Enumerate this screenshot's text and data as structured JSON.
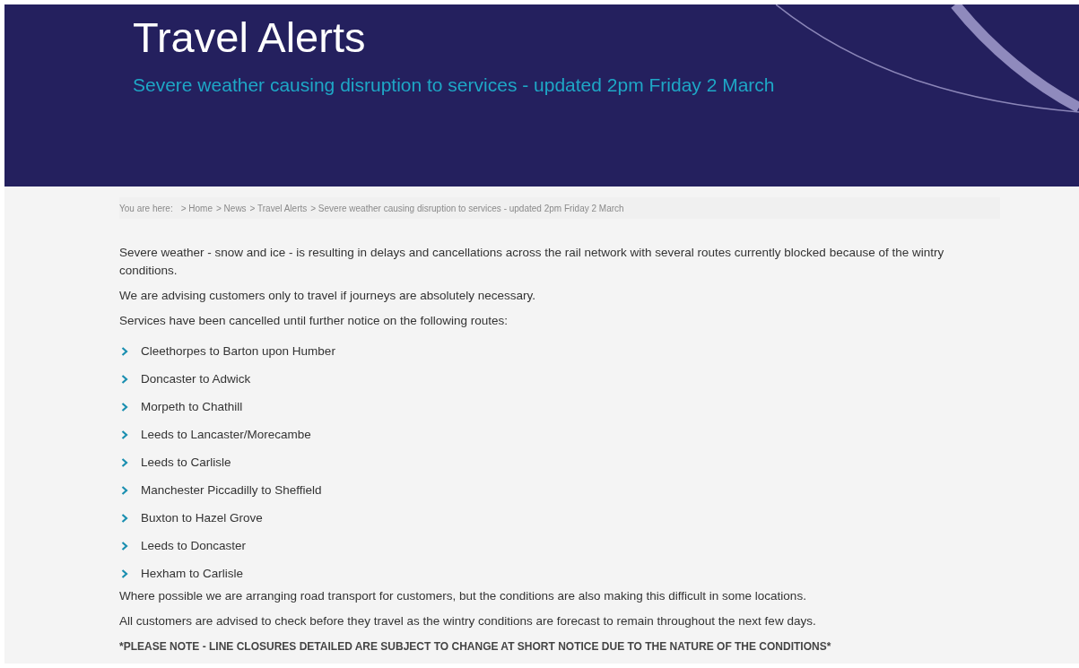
{
  "header": {
    "title": "Travel Alerts",
    "subtitle": "Severe weather causing disruption to services - updated 2pm Friday 2 March"
  },
  "breadcrumb": {
    "label": "You are here:",
    "items": [
      "> Home",
      "> News",
      "> Travel Alerts",
      "> Severe weather causing disruption to services - updated 2pm Friday 2 March"
    ]
  },
  "intro": [
    "Severe weather - snow and ice - is resulting in delays and cancellations across the rail network with several routes currently blocked because of the wintry conditions.",
    "We are advising customers only to travel if journeys are absolutely necessary.",
    "Services have been cancelled until further notice on the following routes:"
  ],
  "routes": [
    "Cleethorpes to Barton upon Humber",
    "Doncaster to Adwick",
    "Morpeth to Chathill",
    "Leeds to Lancaster/Morecambe",
    "Leeds to Carlisle",
    "Manchester Piccadilly to Sheffield",
    "Buxton to Hazel Grove",
    "Leeds to Doncaster",
    "Hexham to Carlisle"
  ],
  "outro": [
    "Where possible we are arranging road transport for customers, but the conditions are also making this difficult in some locations.",
    "All customers are advised to check before they travel  as the wintry conditions are forecast to remain throughout the next few days."
  ],
  "notice": "*PLEASE NOTE - LINE CLOSURES DETAILED ARE SUBJECT TO CHANGE AT SHORT NOTICE DUE TO THE NATURE OF THE CONDITIONS*"
}
